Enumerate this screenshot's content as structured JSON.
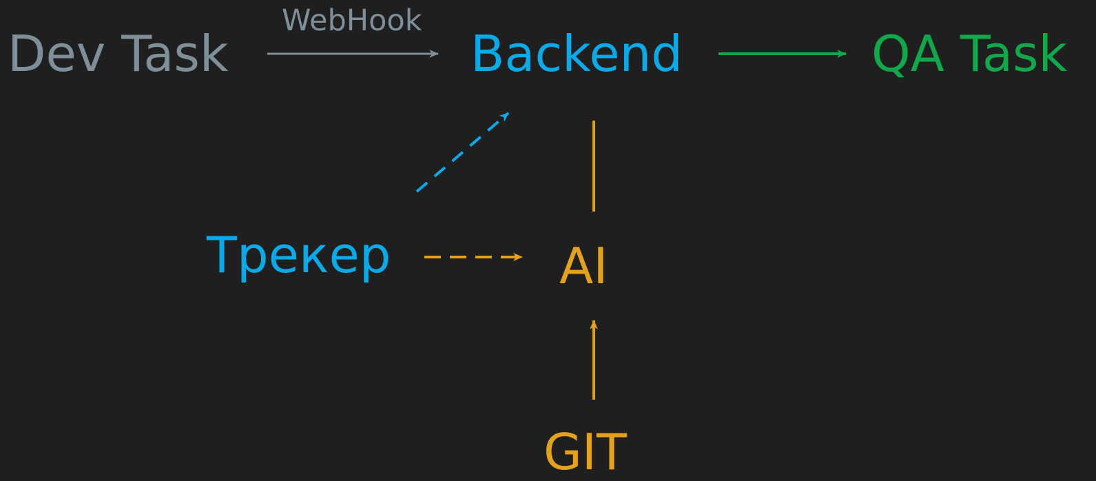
{
  "nodes": {
    "dev_task": {
      "label": "Dev Task"
    },
    "backend": {
      "label": "Backend"
    },
    "qa_task": {
      "label": "QA Task"
    },
    "tracker": {
      "label": "Трекер"
    },
    "ai": {
      "label": "AI"
    },
    "git": {
      "label": "GIT"
    }
  },
  "edges": {
    "webhook_label": "WebHook"
  },
  "colors": {
    "background": "#1f1f1f",
    "gray": "#7f8f9a",
    "blue": "#0aa9e8",
    "green": "#10a84a",
    "orange": "#e3a11d"
  }
}
